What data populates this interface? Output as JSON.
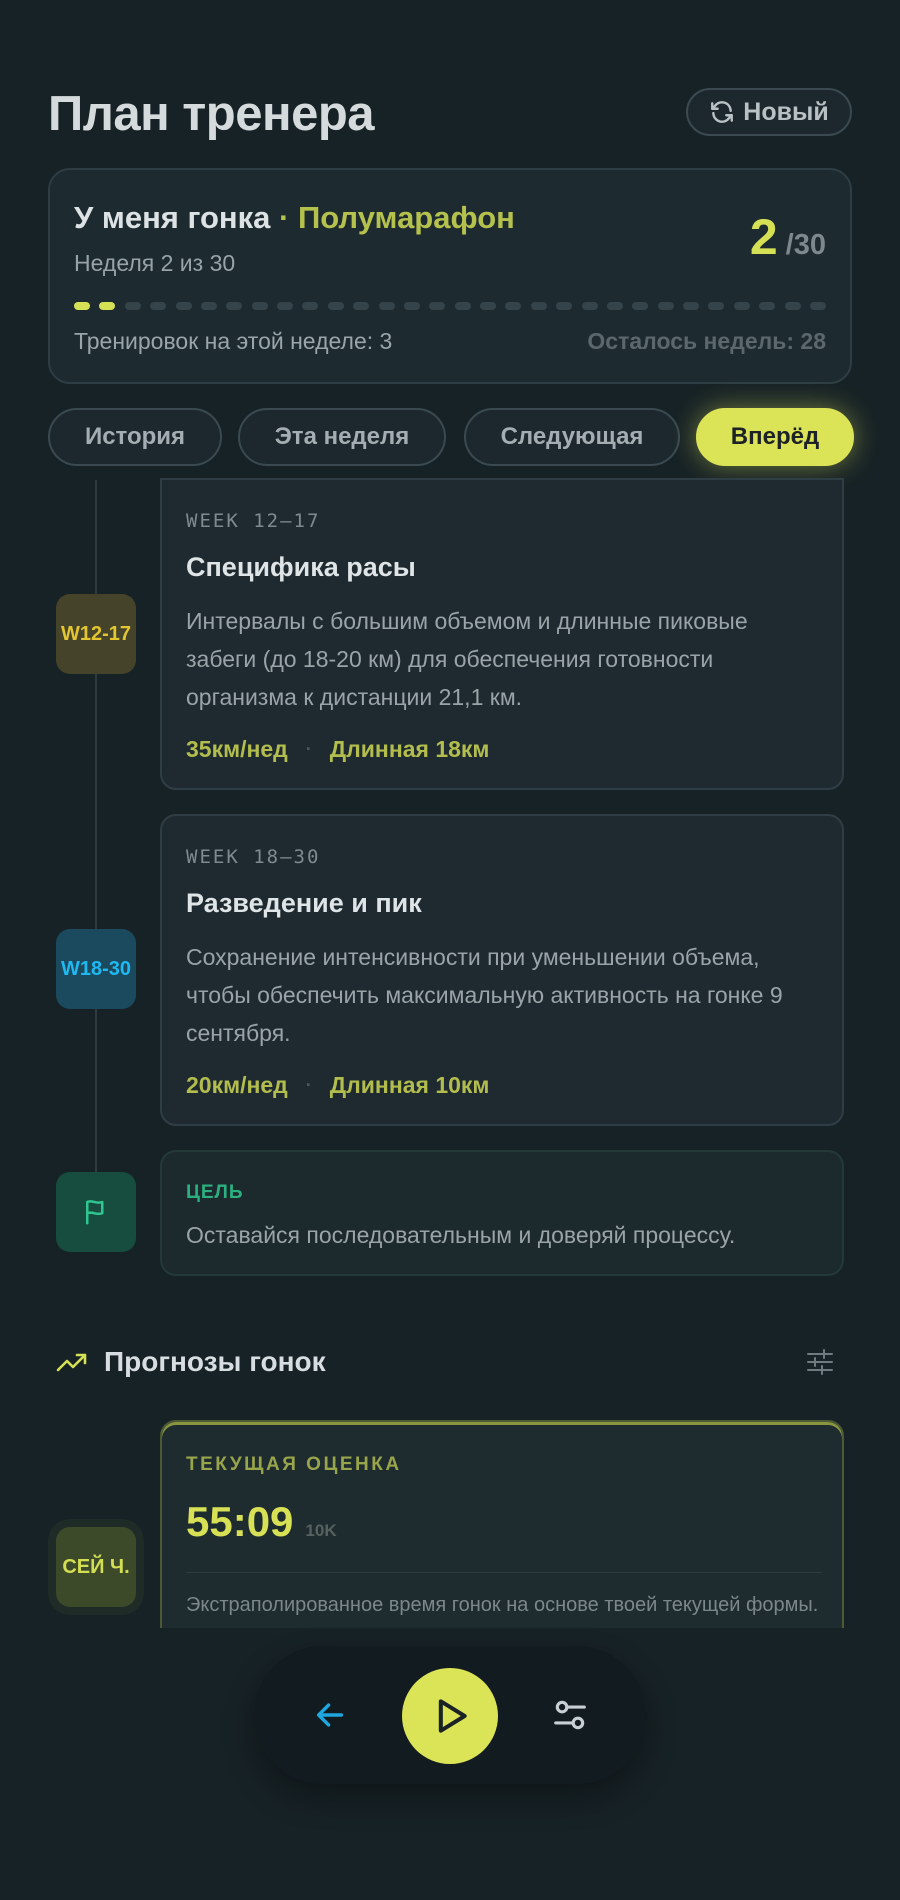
{
  "header": {
    "title": "План тренера",
    "new_button": "Новый"
  },
  "plan": {
    "title_prefix": "У меня гонка",
    "title_sep": " · ",
    "race_type": "Полумарафон",
    "subtitle": "Неделя 2 из 30",
    "current_week": "2",
    "total_weeks": "/30",
    "weeks_done": 2,
    "weeks_total": 30,
    "sessions_text": "Тренировок на этой неделе: 3",
    "weeks_left_text": "Осталось недель: 28"
  },
  "tabs": [
    {
      "label": "История"
    },
    {
      "label": "Эта неделя"
    },
    {
      "label": "Следующая"
    },
    {
      "label": "Вперёд",
      "active": true
    }
  ],
  "phases": [
    {
      "badge": "W12-17",
      "label": "WEEK 12–17",
      "title": "Специфика расы",
      "description": "Интервалы с большим объемом и длинные пиковые забеги (до 18-20 км) для обеспечения готовности организма к дистанции 21,1 км.",
      "volume": "35км/нед",
      "sep": "·",
      "long_run": "Длинная 18км"
    },
    {
      "badge": "W18-30",
      "label": "WEEK 18–30",
      "title": "Разведение и пик",
      "description": "Сохранение интенсивности при уменьшении объема, чтобы обеспечить максимальную активность на гонке 9 сентября.",
      "volume": "20км/нед",
      "sep": "·",
      "long_run": "Длинная 10км"
    }
  ],
  "goal": {
    "label": "ЦЕЛЬ",
    "text": "Оставайся последовательным и доверяй процессу."
  },
  "predictions": {
    "title": "Прогнозы гонок",
    "badge": "СЕЙ Ч.",
    "label": "ТЕКУЩАЯ ОЦЕНКА",
    "time": "55:09",
    "distance": "10K",
    "description": "Экстраполированное время гонок на основе твоей текущей формы."
  },
  "colors": {
    "background": "#172226",
    "accent": "#dbe356",
    "accent_text": "#b2bd4e",
    "week_badge_yellow": "#e3c531",
    "week_badge_blue": "#1fb8f0",
    "goal_green": "#2bb07f"
  },
  "icons": {
    "new": "refresh-icon",
    "goal": "flag-icon",
    "predictions": "trending-up-icon",
    "filter": "sliders-icon",
    "back": "arrow-left-icon",
    "play": "play-icon",
    "settings": "settings-toggles-icon"
  }
}
